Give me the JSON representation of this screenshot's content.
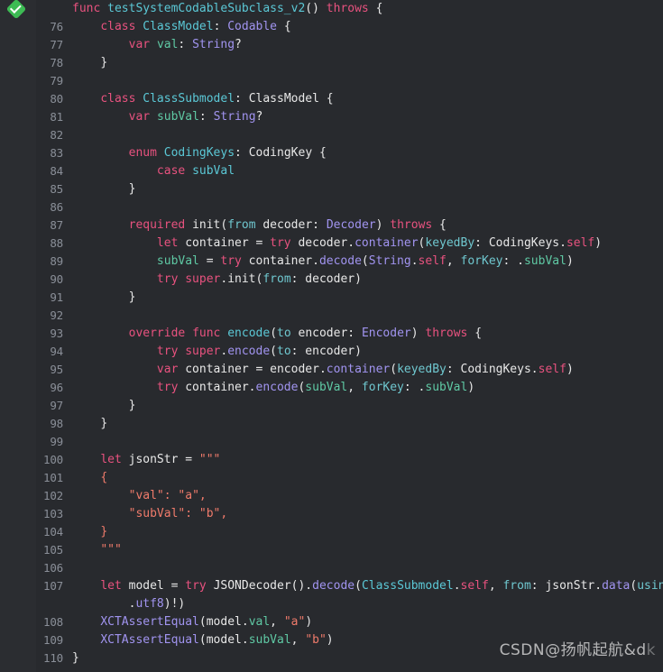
{
  "editor": {
    "language": "Swift",
    "background_color": "#282a2e",
    "gutter_color": "#2b2d31",
    "first_line_number": 76,
    "last_line_number": 110,
    "test_indicator": {
      "name": "test-passed-diamond",
      "color": "#3dbb54",
      "glyph": "check"
    }
  },
  "palette": {
    "keyword": "#e8527f",
    "type": "#5bc8d6",
    "system_type": "#a194f0",
    "property": "#5fc9a4",
    "string": "#f07b6b",
    "plain": "#e8e8e8",
    "param_label": "#6fc7cf",
    "line_number": "#8a8f98"
  },
  "watermark": {
    "prefix": "CSDN",
    "handle": "@扬帆起航&d",
    "trailing": "k"
  },
  "lines": [
    {
      "num": "",
      "indent": 0,
      "tokens": [
        {
          "t": "func",
          "c": "kw"
        },
        {
          "t": " ",
          "c": "plain"
        },
        {
          "t": "testSystemCodableSubclass_v2",
          "c": "type"
        },
        {
          "t": "() ",
          "c": "plain"
        },
        {
          "t": "throws",
          "c": "kw"
        },
        {
          "t": " {",
          "c": "plain"
        }
      ]
    },
    {
      "num": "76",
      "indent": 1,
      "tokens": [
        {
          "t": "class",
          "c": "kw"
        },
        {
          "t": " ",
          "c": "plain"
        },
        {
          "t": "ClassModel",
          "c": "type"
        },
        {
          "t": ": ",
          "c": "plain"
        },
        {
          "t": "Codable",
          "c": "sys"
        },
        {
          "t": " {",
          "c": "plain"
        }
      ]
    },
    {
      "num": "77",
      "indent": 2,
      "tokens": [
        {
          "t": "var",
          "c": "kw"
        },
        {
          "t": " ",
          "c": "plain"
        },
        {
          "t": "val",
          "c": "prop"
        },
        {
          "t": ": ",
          "c": "plain"
        },
        {
          "t": "String",
          "c": "sys"
        },
        {
          "t": "?",
          "c": "plain"
        }
      ]
    },
    {
      "num": "78",
      "indent": 1,
      "tokens": [
        {
          "t": "}",
          "c": "plain"
        }
      ]
    },
    {
      "num": "79",
      "indent": 0,
      "tokens": []
    },
    {
      "num": "80",
      "indent": 1,
      "tokens": [
        {
          "t": "class",
          "c": "kw"
        },
        {
          "t": " ",
          "c": "plain"
        },
        {
          "t": "ClassSubmodel",
          "c": "type"
        },
        {
          "t": ": ",
          "c": "plain"
        },
        {
          "t": "ClassModel",
          "c": "plain"
        },
        {
          "t": " {",
          "c": "plain"
        }
      ]
    },
    {
      "num": "81",
      "indent": 2,
      "tokens": [
        {
          "t": "var",
          "c": "kw"
        },
        {
          "t": " ",
          "c": "plain"
        },
        {
          "t": "subVal",
          "c": "prop"
        },
        {
          "t": ": ",
          "c": "plain"
        },
        {
          "t": "String",
          "c": "sys"
        },
        {
          "t": "?",
          "c": "plain"
        }
      ]
    },
    {
      "num": "82",
      "indent": 0,
      "tokens": []
    },
    {
      "num": "83",
      "indent": 2,
      "tokens": [
        {
          "t": "enum",
          "c": "kw"
        },
        {
          "t": " ",
          "c": "plain"
        },
        {
          "t": "CodingKeys",
          "c": "type"
        },
        {
          "t": ": ",
          "c": "plain"
        },
        {
          "t": "CodingKey",
          "c": "plain"
        },
        {
          "t": " {",
          "c": "plain"
        }
      ]
    },
    {
      "num": "84",
      "indent": 3,
      "tokens": [
        {
          "t": "case",
          "c": "kw"
        },
        {
          "t": " ",
          "c": "plain"
        },
        {
          "t": "subVal",
          "c": "type"
        }
      ]
    },
    {
      "num": "85",
      "indent": 2,
      "tokens": [
        {
          "t": "}",
          "c": "plain"
        }
      ]
    },
    {
      "num": "86",
      "indent": 0,
      "tokens": []
    },
    {
      "num": "87",
      "indent": 2,
      "tokens": [
        {
          "t": "required",
          "c": "kw"
        },
        {
          "t": " ",
          "c": "plain"
        },
        {
          "t": "init",
          "c": "plain"
        },
        {
          "t": "(",
          "c": "plain"
        },
        {
          "t": "from",
          "c": "lbl"
        },
        {
          "t": " decoder: ",
          "c": "plain"
        },
        {
          "t": "Decoder",
          "c": "sys"
        },
        {
          "t": ") ",
          "c": "plain"
        },
        {
          "t": "throws",
          "c": "kw"
        },
        {
          "t": " {",
          "c": "plain"
        }
      ]
    },
    {
      "num": "88",
      "indent": 3,
      "tokens": [
        {
          "t": "let",
          "c": "kw"
        },
        {
          "t": " container = ",
          "c": "plain"
        },
        {
          "t": "try",
          "c": "kw"
        },
        {
          "t": " decoder.",
          "c": "plain"
        },
        {
          "t": "container",
          "c": "sys"
        },
        {
          "t": "(",
          "c": "plain"
        },
        {
          "t": "keyedBy",
          "c": "lbl"
        },
        {
          "t": ": ",
          "c": "plain"
        },
        {
          "t": "CodingKeys",
          "c": "plain"
        },
        {
          "t": ".",
          "c": "plain"
        },
        {
          "t": "self",
          "c": "kw"
        },
        {
          "t": ")",
          "c": "plain"
        }
      ]
    },
    {
      "num": "89",
      "indent": 3,
      "tokens": [
        {
          "t": "subVal",
          "c": "prop"
        },
        {
          "t": " = ",
          "c": "plain"
        },
        {
          "t": "try",
          "c": "kw"
        },
        {
          "t": " container.",
          "c": "plain"
        },
        {
          "t": "decode",
          "c": "sys"
        },
        {
          "t": "(",
          "c": "plain"
        },
        {
          "t": "String",
          "c": "sys"
        },
        {
          "t": ".",
          "c": "plain"
        },
        {
          "t": "self",
          "c": "kw"
        },
        {
          "t": ", ",
          "c": "plain"
        },
        {
          "t": "forKey",
          "c": "lbl"
        },
        {
          "t": ": .",
          "c": "plain"
        },
        {
          "t": "subVal",
          "c": "prop"
        },
        {
          "t": ")",
          "c": "plain"
        }
      ]
    },
    {
      "num": "90",
      "indent": 3,
      "tokens": [
        {
          "t": "try",
          "c": "kw"
        },
        {
          "t": " ",
          "c": "plain"
        },
        {
          "t": "super",
          "c": "kw"
        },
        {
          "t": ".",
          "c": "plain"
        },
        {
          "t": "init",
          "c": "plain"
        },
        {
          "t": "(",
          "c": "plain"
        },
        {
          "t": "from",
          "c": "lbl"
        },
        {
          "t": ": decoder)",
          "c": "plain"
        }
      ]
    },
    {
      "num": "91",
      "indent": 2,
      "tokens": [
        {
          "t": "}",
          "c": "plain"
        }
      ]
    },
    {
      "num": "92",
      "indent": 0,
      "tokens": []
    },
    {
      "num": "93",
      "indent": 2,
      "tokens": [
        {
          "t": "override",
          "c": "kw"
        },
        {
          "t": " ",
          "c": "plain"
        },
        {
          "t": "func",
          "c": "kw"
        },
        {
          "t": " ",
          "c": "plain"
        },
        {
          "t": "encode",
          "c": "type"
        },
        {
          "t": "(",
          "c": "plain"
        },
        {
          "t": "to",
          "c": "lbl"
        },
        {
          "t": " encoder: ",
          "c": "plain"
        },
        {
          "t": "Encoder",
          "c": "sys"
        },
        {
          "t": ") ",
          "c": "plain"
        },
        {
          "t": "throws",
          "c": "kw"
        },
        {
          "t": " {",
          "c": "plain"
        }
      ]
    },
    {
      "num": "94",
      "indent": 3,
      "tokens": [
        {
          "t": "try",
          "c": "kw"
        },
        {
          "t": " ",
          "c": "plain"
        },
        {
          "t": "super",
          "c": "kw"
        },
        {
          "t": ".",
          "c": "plain"
        },
        {
          "t": "encode",
          "c": "sys"
        },
        {
          "t": "(",
          "c": "plain"
        },
        {
          "t": "to",
          "c": "lbl"
        },
        {
          "t": ": encoder)",
          "c": "plain"
        }
      ]
    },
    {
      "num": "95",
      "indent": 3,
      "tokens": [
        {
          "t": "var",
          "c": "kw"
        },
        {
          "t": " container = encoder.",
          "c": "plain"
        },
        {
          "t": "container",
          "c": "sys"
        },
        {
          "t": "(",
          "c": "plain"
        },
        {
          "t": "keyedBy",
          "c": "lbl"
        },
        {
          "t": ": ",
          "c": "plain"
        },
        {
          "t": "CodingKeys",
          "c": "plain"
        },
        {
          "t": ".",
          "c": "plain"
        },
        {
          "t": "self",
          "c": "kw"
        },
        {
          "t": ")",
          "c": "plain"
        }
      ]
    },
    {
      "num": "96",
      "indent": 3,
      "tokens": [
        {
          "t": "try",
          "c": "kw"
        },
        {
          "t": " container.",
          "c": "plain"
        },
        {
          "t": "encode",
          "c": "sys"
        },
        {
          "t": "(",
          "c": "plain"
        },
        {
          "t": "subVal",
          "c": "prop"
        },
        {
          "t": ", ",
          "c": "plain"
        },
        {
          "t": "forKey",
          "c": "lbl"
        },
        {
          "t": ": .",
          "c": "plain"
        },
        {
          "t": "subVal",
          "c": "prop"
        },
        {
          "t": ")",
          "c": "plain"
        }
      ]
    },
    {
      "num": "97",
      "indent": 2,
      "tokens": [
        {
          "t": "}",
          "c": "plain"
        }
      ]
    },
    {
      "num": "98",
      "indent": 1,
      "tokens": [
        {
          "t": "}",
          "c": "plain"
        }
      ]
    },
    {
      "num": "99",
      "indent": 0,
      "tokens": []
    },
    {
      "num": "100",
      "indent": 1,
      "tokens": [
        {
          "t": "let",
          "c": "kw"
        },
        {
          "t": " jsonStr = ",
          "c": "plain"
        },
        {
          "t": "\"\"\"",
          "c": "str"
        }
      ]
    },
    {
      "num": "101",
      "indent": 1,
      "tokens": [
        {
          "t": "{",
          "c": "str"
        }
      ]
    },
    {
      "num": "102",
      "indent": 2,
      "tokens": [
        {
          "t": "\"val\": \"a\",",
          "c": "str"
        }
      ]
    },
    {
      "num": "103",
      "indent": 2,
      "tokens": [
        {
          "t": "\"subVal\": \"b\",",
          "c": "str"
        }
      ]
    },
    {
      "num": "104",
      "indent": 1,
      "tokens": [
        {
          "t": "}",
          "c": "str"
        }
      ]
    },
    {
      "num": "105",
      "indent": 1,
      "tokens": [
        {
          "t": "\"\"\"",
          "c": "str"
        }
      ]
    },
    {
      "num": "106",
      "indent": 0,
      "tokens": []
    },
    {
      "num": "107",
      "indent": 1,
      "tokens": [
        {
          "t": "let",
          "c": "kw"
        },
        {
          "t": " model = ",
          "c": "plain"
        },
        {
          "t": "try",
          "c": "kw"
        },
        {
          "t": " ",
          "c": "plain"
        },
        {
          "t": "JSONDecoder",
          "c": "plain"
        },
        {
          "t": "().",
          "c": "plain"
        },
        {
          "t": "decode",
          "c": "sys"
        },
        {
          "t": "(",
          "c": "plain"
        },
        {
          "t": "ClassSubmodel",
          "c": "type"
        },
        {
          "t": ".",
          "c": "plain"
        },
        {
          "t": "self",
          "c": "kw"
        },
        {
          "t": ", ",
          "c": "plain"
        },
        {
          "t": "from",
          "c": "lbl"
        },
        {
          "t": ": jsonStr.",
          "c": "plain"
        },
        {
          "t": "data",
          "c": "sys"
        },
        {
          "t": "(",
          "c": "plain"
        },
        {
          "t": "using",
          "c": "lbl"
        },
        {
          "t": ":",
          "c": "plain"
        }
      ]
    },
    {
      "num": "",
      "indent": 2,
      "tokens": [
        {
          "t": ".",
          "c": "plain"
        },
        {
          "t": "utf8",
          "c": "sys"
        },
        {
          "t": ")!)",
          "c": "plain"
        }
      ]
    },
    {
      "num": "108",
      "indent": 1,
      "tokens": [
        {
          "t": "XCTAssertEqual",
          "c": "sys"
        },
        {
          "t": "(model.",
          "c": "plain"
        },
        {
          "t": "val",
          "c": "prop"
        },
        {
          "t": ", ",
          "c": "plain"
        },
        {
          "t": "\"a\"",
          "c": "str"
        },
        {
          "t": ")",
          "c": "plain"
        }
      ]
    },
    {
      "num": "109",
      "indent": 1,
      "tokens": [
        {
          "t": "XCTAssertEqual",
          "c": "sys"
        },
        {
          "t": "(model.",
          "c": "plain"
        },
        {
          "t": "subVal",
          "c": "prop"
        },
        {
          "t": ", ",
          "c": "plain"
        },
        {
          "t": "\"b\"",
          "c": "str"
        },
        {
          "t": ")",
          "c": "plain"
        }
      ]
    },
    {
      "num": "110",
      "indent": 0,
      "tokens": [
        {
          "t": "}",
          "c": "plain"
        }
      ]
    }
  ]
}
